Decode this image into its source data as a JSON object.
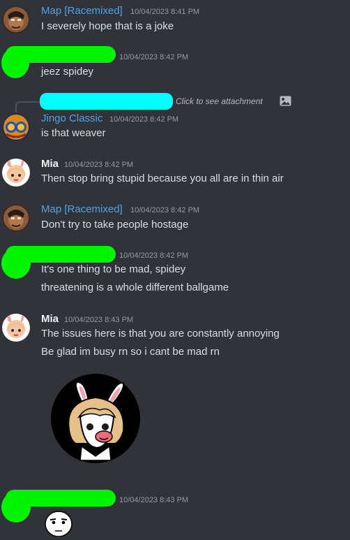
{
  "messages": [
    {
      "author": "Map [Racemixed]",
      "timestamp": "10/04/2023 8:41 PM",
      "lines": [
        "I severely hope that is a joke"
      ]
    },
    {
      "author": "",
      "timestamp": "10/04/2023 8:42 PM",
      "lines": [
        "jeez spidey"
      ]
    },
    {
      "author": "Jingo Classic",
      "timestamp": "10/04/2023 8:42 PM",
      "lines": [
        "is that weaver"
      ],
      "reply_text": "Click to see attachment"
    },
    {
      "author": "Mia",
      "timestamp": "10/04/2023 8:42 PM",
      "lines": [
        "Then stop bring stupid because you all are in thin air"
      ]
    },
    {
      "author": "Map [Racemixed]",
      "timestamp": "10/04/2023 8:42 PM",
      "lines": [
        "Don't try to take people hostage"
      ]
    },
    {
      "author": "",
      "timestamp": "10/04/2023 8:42 PM",
      "lines": [
        "It's one thing to be mad, spidey",
        "threatening is a whole different ballgame"
      ]
    },
    {
      "author": "Mia",
      "timestamp": "10/04/2023 8:43 PM",
      "lines": [
        "The issues here is that you are constantly annoying",
        "Be glad im busy rn so i cant be mad rn"
      ]
    },
    {
      "author": "",
      "timestamp": "10/04/2023 8:43 PM",
      "lines": []
    }
  ],
  "colors": {
    "background": "#313338",
    "username_blue": "#4ba3ee",
    "username_white": "#f2f3f5",
    "timestamp": "#949ba4",
    "text": "#dbdee1",
    "redaction_green": "#00f400",
    "redaction_cyan": "#00ffff"
  }
}
